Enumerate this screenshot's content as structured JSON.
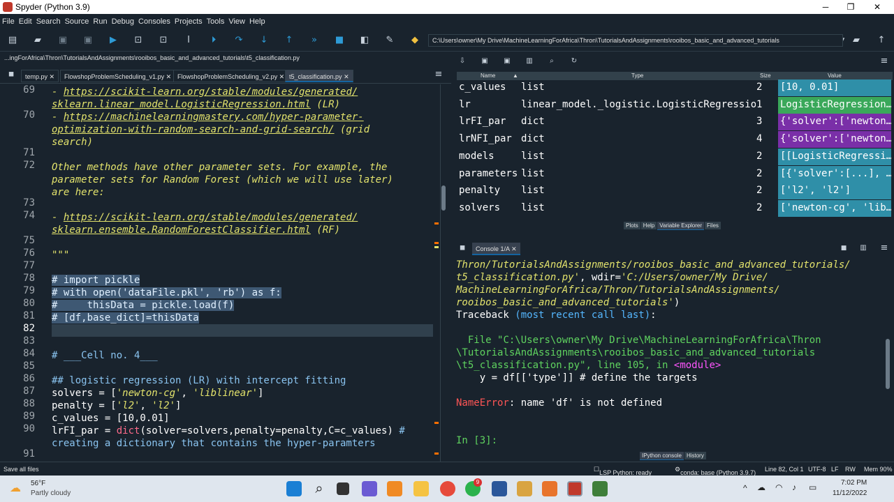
{
  "window": {
    "title": "Spyder (Python 3.9)",
    "minimize": "─",
    "maximize": "❐",
    "close": "✕"
  },
  "menu": [
    "File",
    "Edit",
    "Search",
    "Source",
    "Run",
    "Debug",
    "Consoles",
    "Projects",
    "Tools",
    "View",
    "Help"
  ],
  "toolbar": {
    "path": "C:\\Users\\owner\\My Drive\\MachineLearningForAfrica\\Thron\\TutorialsAndAssignments\\rooibos_basic_and_advanced_tutorials"
  },
  "editor": {
    "filepath": "...ingForAfrica\\Thron\\TutorialsAndAssignments\\rooibos_basic_and_advanced_tutorials\\t5_classification.py",
    "tabs": [
      {
        "label": "temp.py",
        "close": "✕"
      },
      {
        "label": "FlowshopProblemScheduling_v1.py",
        "close": "✕"
      },
      {
        "label": "FlowshopProblemScheduling_v2.py",
        "close": "✕"
      },
      {
        "label": "t5_classification.py",
        "close": "✕"
      }
    ],
    "line_numbers": [
      {
        "n": "69",
        "row": 0
      },
      {
        "n": "70",
        "row": 2
      },
      {
        "n": "71",
        "row": 5
      },
      {
        "n": "72",
        "row": 6
      },
      {
        "n": "73",
        "row": 9
      },
      {
        "n": "74",
        "row": 10
      },
      {
        "n": "75",
        "row": 12
      },
      {
        "n": "76",
        "row": 13
      },
      {
        "n": "77",
        "row": 14
      },
      {
        "n": "78",
        "row": 15
      },
      {
        "n": "79",
        "row": 16
      },
      {
        "n": "80",
        "row": 17
      },
      {
        "n": "81",
        "row": 18
      },
      {
        "n": "82",
        "row": 19
      },
      {
        "n": "83",
        "row": 20
      },
      {
        "n": "84",
        "row": 21
      },
      {
        "n": "85",
        "row": 22
      },
      {
        "n": "86",
        "row": 23
      },
      {
        "n": "87",
        "row": 24
      },
      {
        "n": "88",
        "row": 25
      },
      {
        "n": "89",
        "row": 26
      },
      {
        "n": "90",
        "row": 27
      },
      {
        "n": "91",
        "row": 29
      }
    ],
    "lines": [
      [
        {
          "t": "- ",
          "c": "doc"
        },
        {
          "t": "https://scikit-learn.org/stable/modules/generated/",
          "c": "lnk"
        }
      ],
      [
        {
          "t": "sklearn.linear_model.LogisticRegression.html",
          "c": "lnk"
        },
        {
          "t": " (LR)",
          "c": "doc"
        }
      ],
      [
        {
          "t": "- ",
          "c": "doc"
        },
        {
          "t": "https://machinelearningmastery.com/hyper-parameter-",
          "c": "lnk"
        }
      ],
      [
        {
          "t": "optimization-with-random-search-and-grid-search/",
          "c": "lnk"
        },
        {
          "t": " (grid",
          "c": "doc"
        }
      ],
      [
        {
          "t": "search)",
          "c": "doc"
        }
      ],
      [
        {
          "t": "",
          "c": "doc"
        }
      ],
      [
        {
          "t": "Other methods have other parameter sets. For example, the",
          "c": "doc"
        }
      ],
      [
        {
          "t": "parameter sets for Random Forest (which we will use later)",
          "c": "doc"
        }
      ],
      [
        {
          "t": "are here:",
          "c": "doc"
        }
      ],
      [
        {
          "t": "",
          "c": "doc"
        }
      ],
      [
        {
          "t": "- ",
          "c": "doc"
        },
        {
          "t": "https://scikit-learn.org/stable/modules/generated/",
          "c": "lnk"
        }
      ],
      [
        {
          "t": "sklearn.ensemble.RandomForestClassifier.html",
          "c": "lnk"
        },
        {
          "t": " (RF)",
          "c": "doc"
        }
      ],
      [
        {
          "t": "",
          "c": "doc"
        }
      ],
      [
        {
          "t": "\"\"\"",
          "c": "doc"
        }
      ],
      [
        {
          "t": "",
          "c": "plain"
        }
      ],
      [
        {
          "t": "# import pickle",
          "c": "cmtsel"
        }
      ],
      [
        {
          "t": "# with open('dataFile.pkl', 'rb') as f:",
          "c": "cmtsel"
        }
      ],
      [
        {
          "t": "#     thisData = pickle.load(f)",
          "c": "cmtsel"
        }
      ],
      [
        {
          "t": "# [df,base_dict]=thisData",
          "c": "cmtsel"
        }
      ],
      [
        {
          "t": "",
          "c": "plain"
        }
      ],
      [
        {
          "t": "",
          "c": "plain"
        }
      ],
      [
        {
          "t": "# ___Cell no. 4___",
          "c": "cmt"
        }
      ],
      [
        {
          "t": "",
          "c": "plain"
        }
      ],
      [
        {
          "t": "## logistic regression (LR) with intercept fitting",
          "c": "cmt"
        }
      ],
      [
        {
          "t": "solvers = [",
          "c": "plain"
        },
        {
          "t": "'newton-cg'",
          "c": "str"
        },
        {
          "t": ", ",
          "c": "plain"
        },
        {
          "t": "'liblinear'",
          "c": "str"
        },
        {
          "t": "]",
          "c": "plain"
        }
      ],
      [
        {
          "t": "penalty = [",
          "c": "plain"
        },
        {
          "t": "'l2'",
          "c": "str"
        },
        {
          "t": ", ",
          "c": "plain"
        },
        {
          "t": "'l2'",
          "c": "str"
        },
        {
          "t": "]",
          "c": "plain"
        }
      ],
      [
        {
          "t": "c_values = [10,0.01]",
          "c": "plain"
        }
      ],
      [
        {
          "t": "lrFI_par = ",
          "c": "plain"
        },
        {
          "t": "dict",
          "c": "bi"
        },
        {
          "t": "(solver=solvers,penalty=penalty,C=c_values) ",
          "c": "plain"
        },
        {
          "t": "#",
          "c": "cmt"
        }
      ],
      [
        {
          "t": "creating a dictionary that contains the hyper-paramters",
          "c": "cmt"
        }
      ],
      [
        {
          "t": "",
          "c": "plain"
        }
      ]
    ]
  },
  "variable_explorer": {
    "headers": {
      "name": "Name",
      "type": "Type",
      "size": "Size",
      "value": "Value"
    },
    "rows": [
      {
        "name": "c_values",
        "type": "list",
        "size": "2",
        "value": "[10, 0.01]",
        "color": "#2f8fa8"
      },
      {
        "name": "lr",
        "type": "linear_model._logistic.LogisticRegression",
        "size": "1",
        "value": "LogisticRegression…",
        "color": "#3aa85a"
      },
      {
        "name": "lrFI_par",
        "type": "dict",
        "size": "3",
        "value": "{'solver':['newton…",
        "color": "#7a2fa8"
      },
      {
        "name": "lrNFI_par",
        "type": "dict",
        "size": "4",
        "value": "{'solver':['newton…",
        "color": "#7a2fa8"
      },
      {
        "name": "models",
        "type": "list",
        "size": "2",
        "value": "[[LogisticRegressi…",
        "color": "#2f8fa8"
      },
      {
        "name": "parameters",
        "type": "list",
        "size": "2",
        "value": "[{'solver':[...], …",
        "color": "#2f8fa8"
      },
      {
        "name": "penalty",
        "type": "list",
        "size": "2",
        "value": "['l2', 'l2']",
        "color": "#2f8fa8"
      },
      {
        "name": "solvers",
        "type": "list",
        "size": "2",
        "value": "['newton-cg', 'lib…",
        "color": "#2f8fa8"
      }
    ],
    "panel_tabs": [
      "Plots",
      "Help",
      "Variable Explorer",
      "Files"
    ]
  },
  "console": {
    "tab": "Console 1/A",
    "lines": [
      [
        {
          "t": "Thron/TutorialsAndAssignments/rooibos_basic_and_advanced_tutorials/",
          "c": "c-ital"
        }
      ],
      [
        {
          "t": "t5_classification.py'",
          "c": "c-ital"
        },
        {
          "t": ", wdir=",
          "c": "c-wht"
        },
        {
          "t": "'C:/Users/owner/My Drive/",
          "c": "c-ital"
        }
      ],
      [
        {
          "t": "MachineLearningForAfrica/Thron/TutorialsAndAssignments/",
          "c": "c-ital"
        }
      ],
      [
        {
          "t": "rooibos_basic_and_advanced_tutorials'",
          "c": "c-ital"
        },
        {
          "t": ")",
          "c": "c-wht"
        }
      ],
      [
        {
          "t": "Traceback ",
          "c": "c-wht"
        },
        {
          "t": "(most recent call last)",
          "c": "c-cyan"
        },
        {
          "t": ":",
          "c": "c-wht"
        }
      ],
      [
        {
          "t": "",
          "c": "c-wht"
        }
      ],
      [
        {
          "t": "  File ",
          "c": "c-grn"
        },
        {
          "t": "\"C:\\Users\\owner\\My Drive\\MachineLearningForAfrica\\Thron",
          "c": "c-grn"
        }
      ],
      [
        {
          "t": "\\TutorialsAndAssignments\\rooibos_basic_and_advanced_tutorials",
          "c": "c-grn"
        }
      ],
      [
        {
          "t": "\\t5_classification.py\"",
          "c": "c-grn"
        },
        {
          "t": ", line 105",
          "c": "c-grn"
        },
        {
          "t": ", in ",
          "c": "c-grn"
        },
        {
          "t": "<module>",
          "c": "c-mag"
        }
      ],
      [
        {
          "t": "    y = df[['type']] # define the targets",
          "c": "c-wht"
        }
      ],
      [
        {
          "t": "",
          "c": "c-wht"
        }
      ],
      [
        {
          "t": "NameError",
          "c": "c-red"
        },
        {
          "t": ": name 'df' is not defined",
          "c": "c-wht"
        }
      ],
      [
        {
          "t": "",
          "c": "c-wht"
        }
      ],
      [
        {
          "t": "",
          "c": "c-wht"
        }
      ],
      [
        {
          "t": "In [",
          "c": "c-grn"
        },
        {
          "t": "3",
          "c": "c-grn"
        },
        {
          "t": "]:",
          "c": "c-grn"
        }
      ]
    ],
    "panel_tabs": [
      "IPython console",
      "History"
    ]
  },
  "statusbar": {
    "left": "Save all files",
    "lsp": "LSP Python: ready",
    "env": "conda: base (Python 3.9.7)",
    "pos": "Line 82, Col 1",
    "enc": "UTF-8",
    "eol": "LF",
    "rw": "RW",
    "mem": "Mem 90%"
  },
  "taskbar": {
    "temp": "56°F",
    "weather": "Partly cloudy",
    "time": "7:02 PM",
    "date": "11/12/2022",
    "badge": "9"
  }
}
